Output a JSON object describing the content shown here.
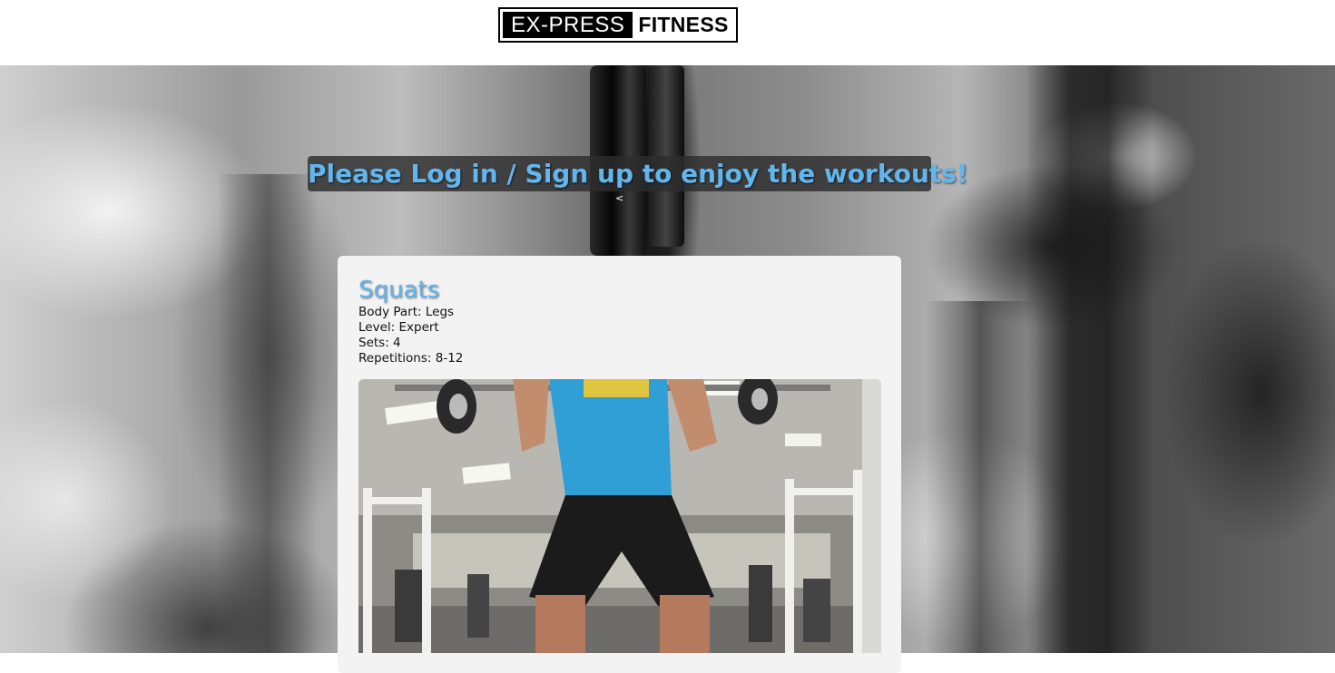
{
  "header": {
    "logo_left": "EX-PRESS",
    "logo_right": "FITNESS"
  },
  "hero": {
    "login_prompt": "Please Log in / Sign up to enjoy the workouts!",
    "chevron": "<"
  },
  "workout": {
    "title": "Squats",
    "body_part": "Body Part: Legs",
    "level": "Level: Expert",
    "sets": "Sets: 4",
    "repetitions": "Repetitions: 8-12",
    "video_icon": "squat-video-thumbnail"
  },
  "colors": {
    "accent": "#62b6ee",
    "banner_bg": "#2d2d2d",
    "card_bg": "#f3f3f3"
  }
}
